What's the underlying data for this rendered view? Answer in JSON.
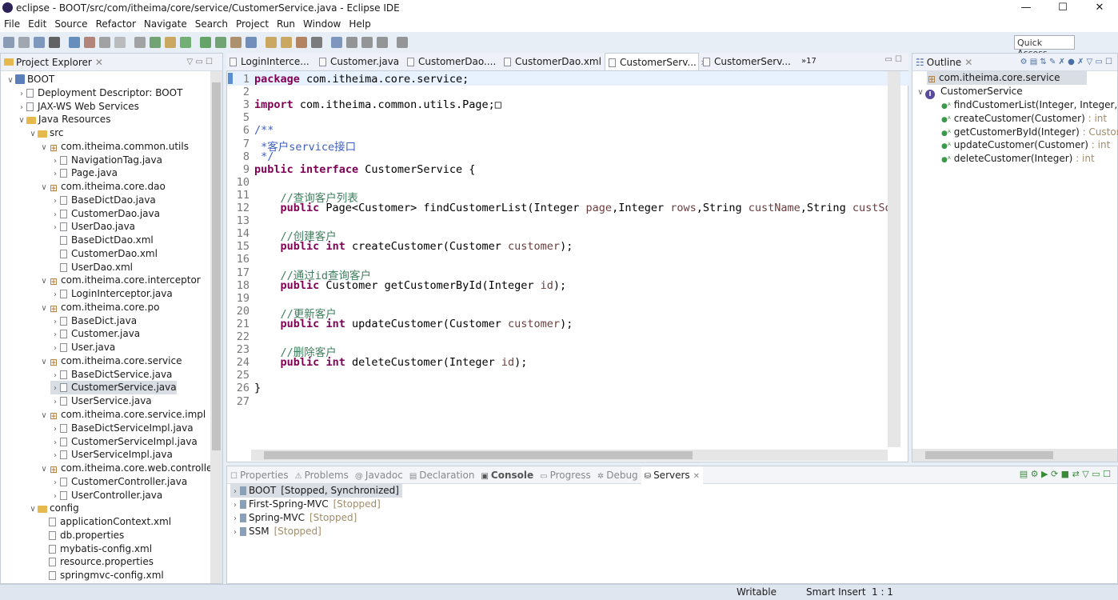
{
  "window": {
    "title": "eclipse - BOOT/src/com/itheima/core/service/CustomerService.java - Eclipse IDE",
    "controls": [
      "—",
      "☐",
      "✕"
    ]
  },
  "menu": [
    "File",
    "Edit",
    "Source",
    "Refactor",
    "Navigate",
    "Search",
    "Project",
    "Run",
    "Window",
    "Help"
  ],
  "toolbar": {
    "quick_access": "Quick Access"
  },
  "explorer": {
    "title": "Project Explorer",
    "items": [
      {
        "d": 0,
        "c": "v",
        "i": "proj",
        "l": "BOOT"
      },
      {
        "d": 1,
        "c": ">",
        "i": "file",
        "l": "Deployment Descriptor: BOOT"
      },
      {
        "d": 1,
        "c": ">",
        "i": "file",
        "l": "JAX-WS Web Services"
      },
      {
        "d": 1,
        "c": "v",
        "i": "folder",
        "l": "Java Resources"
      },
      {
        "d": 2,
        "c": "v",
        "i": "folder",
        "l": "src"
      },
      {
        "d": 3,
        "c": "v",
        "i": "pkg",
        "l": "com.itheima.common.utils"
      },
      {
        "d": 4,
        "c": ">",
        "i": "file",
        "l": "NavigationTag.java"
      },
      {
        "d": 4,
        "c": ">",
        "i": "file",
        "l": "Page.java"
      },
      {
        "d": 3,
        "c": "v",
        "i": "pkg",
        "l": "com.itheima.core.dao"
      },
      {
        "d": 4,
        "c": ">",
        "i": "file",
        "l": "BaseDictDao.java"
      },
      {
        "d": 4,
        "c": ">",
        "i": "file",
        "l": "CustomerDao.java"
      },
      {
        "d": 4,
        "c": ">",
        "i": "file",
        "l": "UserDao.java"
      },
      {
        "d": 4,
        "c": "",
        "i": "file",
        "l": "BaseDictDao.xml"
      },
      {
        "d": 4,
        "c": "",
        "i": "file",
        "l": "CustomerDao.xml"
      },
      {
        "d": 4,
        "c": "",
        "i": "file",
        "l": "UserDao.xml"
      },
      {
        "d": 3,
        "c": "v",
        "i": "pkg",
        "l": "com.itheima.core.interceptor"
      },
      {
        "d": 4,
        "c": ">",
        "i": "file",
        "l": "LoginInterceptor.java"
      },
      {
        "d": 3,
        "c": "v",
        "i": "pkg",
        "l": "com.itheima.core.po"
      },
      {
        "d": 4,
        "c": ">",
        "i": "file",
        "l": "BaseDict.java"
      },
      {
        "d": 4,
        "c": ">",
        "i": "file",
        "l": "Customer.java"
      },
      {
        "d": 4,
        "c": ">",
        "i": "file",
        "l": "User.java"
      },
      {
        "d": 3,
        "c": "v",
        "i": "pkg",
        "l": "com.itheima.core.service"
      },
      {
        "d": 4,
        "c": ">",
        "i": "file",
        "l": "BaseDictService.java"
      },
      {
        "d": 4,
        "c": ">",
        "i": "file",
        "l": "CustomerService.java",
        "sel": true
      },
      {
        "d": 4,
        "c": ">",
        "i": "file",
        "l": "UserService.java"
      },
      {
        "d": 3,
        "c": "v",
        "i": "pkg",
        "l": "com.itheima.core.service.impl"
      },
      {
        "d": 4,
        "c": ">",
        "i": "file",
        "l": "BaseDictServiceImpl.java"
      },
      {
        "d": 4,
        "c": ">",
        "i": "file",
        "l": "CustomerServiceImpl.java"
      },
      {
        "d": 4,
        "c": ">",
        "i": "file",
        "l": "UserServiceImpl.java"
      },
      {
        "d": 3,
        "c": "v",
        "i": "pkg",
        "l": "com.itheima.core.web.controller"
      },
      {
        "d": 4,
        "c": ">",
        "i": "file",
        "l": "CustomerController.java"
      },
      {
        "d": 4,
        "c": ">",
        "i": "file",
        "l": "UserController.java"
      },
      {
        "d": 2,
        "c": "v",
        "i": "folder",
        "l": "config"
      },
      {
        "d": 3,
        "c": "",
        "i": "file",
        "l": "applicationContext.xml"
      },
      {
        "d": 3,
        "c": "",
        "i": "file",
        "l": "db.properties"
      },
      {
        "d": 3,
        "c": "",
        "i": "file",
        "l": "mybatis-config.xml"
      },
      {
        "d": 3,
        "c": "",
        "i": "file",
        "l": "resource.properties"
      },
      {
        "d": 3,
        "c": "",
        "i": "file",
        "l": "springmvc-config.xml"
      }
    ]
  },
  "editor": {
    "tabs": [
      "LoginInterce...",
      "Customer.java",
      "CustomerDao....",
      "CustomerDao.xml",
      "CustomerServ...",
      "CustomerServ..."
    ],
    "active_tab": 4,
    "overflow": "»17",
    "lines": [
      [
        [
          "package",
          "kw"
        ],
        [
          " com.itheima.core.service;",
          "tx"
        ]
      ],
      [],
      [
        [
          "import",
          "kw"
        ],
        [
          " com.itheima.common.utils.Page;",
          "tx"
        ],
        [
          "□",
          "tx"
        ]
      ],
      [],
      [
        [
          "/**",
          "jd"
        ]
      ],
      [
        [
          " *客户service接口",
          "jd"
        ]
      ],
      [
        [
          " */",
          "jd"
        ]
      ],
      [
        [
          "public",
          "kw"
        ],
        [
          " ",
          "tx"
        ],
        [
          "interface",
          "kw"
        ],
        [
          " CustomerService {",
          "tx"
        ]
      ],
      [],
      [
        [
          "    //查询客户列表",
          "cm"
        ]
      ],
      [
        [
          "    ",
          "tx"
        ],
        [
          "public",
          "kw"
        ],
        [
          " Page<Customer> findCustomerList(Integer ",
          "tx"
        ],
        [
          "page",
          "pr"
        ],
        [
          ",Integer ",
          "tx"
        ],
        [
          "rows",
          "pr"
        ],
        [
          ",String ",
          "tx"
        ],
        [
          "custName",
          "pr"
        ],
        [
          ",String ",
          "tx"
        ],
        [
          "custSou",
          "pr"
        ]
      ],
      [],
      [
        [
          "    //创建客户",
          "cm"
        ]
      ],
      [
        [
          "    ",
          "tx"
        ],
        [
          "public",
          "kw"
        ],
        [
          " ",
          "tx"
        ],
        [
          "int",
          "kw"
        ],
        [
          " createCustomer(Customer ",
          "tx"
        ],
        [
          "customer",
          "pr"
        ],
        [
          ");",
          "tx"
        ]
      ],
      [],
      [
        [
          "    //通过id查询客户",
          "cm"
        ]
      ],
      [
        [
          "    ",
          "tx"
        ],
        [
          "public",
          "kw"
        ],
        [
          " Customer getCustomerById(Integer ",
          "tx"
        ],
        [
          "id",
          "pr"
        ],
        [
          ");",
          "tx"
        ]
      ],
      [],
      [
        [
          "    //更新客户",
          "cm"
        ]
      ],
      [
        [
          "    ",
          "tx"
        ],
        [
          "public",
          "kw"
        ],
        [
          " ",
          "tx"
        ],
        [
          "int",
          "kw"
        ],
        [
          " updateCustomer(Customer ",
          "tx"
        ],
        [
          "customer",
          "pr"
        ],
        [
          ");",
          "tx"
        ]
      ],
      [],
      [
        [
          "    //删除客户",
          "cm"
        ]
      ],
      [
        [
          "    ",
          "tx"
        ],
        [
          "public",
          "kw"
        ],
        [
          " ",
          "tx"
        ],
        [
          "int",
          "kw"
        ],
        [
          " deleteCustomer(Integer ",
          "tx"
        ],
        [
          "id",
          "pr"
        ],
        [
          ");",
          "tx"
        ]
      ],
      [],
      [
        [
          "}",
          "tx"
        ]
      ],
      []
    ],
    "line_numbers": [
      "1",
      "2",
      "3",
      "5",
      "6",
      "7",
      "8",
      "9",
      "10",
      "11",
      "12",
      "13",
      "14",
      "15",
      "16",
      "17",
      "18",
      "19",
      "20",
      "21",
      "22",
      "23",
      "24",
      "25",
      "26",
      "27"
    ]
  },
  "outline": {
    "title": "Outline",
    "package": "com.itheima.core.service",
    "interface": "CustomerService",
    "methods": [
      {
        "n": "findCustomerList(Integer, Integer, Stri",
        "t": ""
      },
      {
        "n": "createCustomer(Customer)",
        "t": " : int"
      },
      {
        "n": "getCustomerById(Integer)",
        "t": " : Customer"
      },
      {
        "n": "updateCustomer(Customer)",
        "t": " : int"
      },
      {
        "n": "deleteCustomer(Integer)",
        "t": " : int"
      }
    ]
  },
  "bottom": {
    "tabs": [
      "Properties",
      "Problems",
      "Javadoc",
      "Declaration",
      "Console",
      "Progress",
      "Debug",
      "Servers"
    ],
    "active_tab": 7,
    "servers": [
      {
        "n": "BOOT",
        "s": "[Stopped, Synchronized]"
      },
      {
        "n": "First-Spring-MVC",
        "s": "[Stopped]"
      },
      {
        "n": "Spring-MVC",
        "s": "[Stopped]"
      },
      {
        "n": "SSM",
        "s": "[Stopped]"
      }
    ]
  },
  "status": {
    "writable": "Writable",
    "insert": "Smart Insert",
    "pos": "1 : 1"
  },
  "colors": {
    "keyword": "#7f0055",
    "comment": "#3f7f5f",
    "javadoc": "#3f5fbf"
  }
}
